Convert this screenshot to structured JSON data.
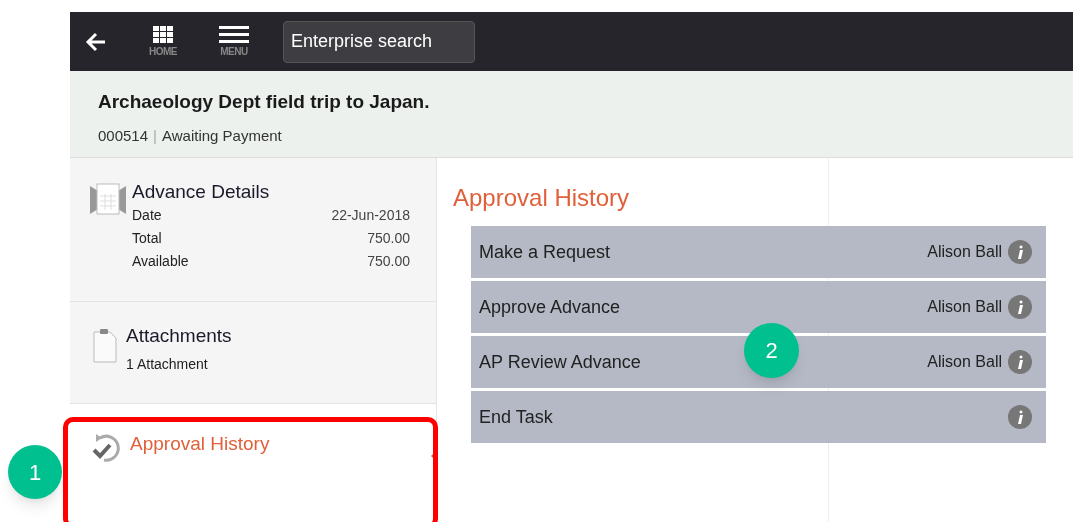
{
  "top_bar": {
    "home_label": "HOME",
    "menu_label": "MENU",
    "search": {
      "placeholder": "Enterprise search"
    }
  },
  "header": {
    "title": "Archaeology Dept field trip to Japan.",
    "number": "000514",
    "separator": "|",
    "status": "Awaiting Payment"
  },
  "sidebar": {
    "items": [
      {
        "kind": "details",
        "title": "Advance Details",
        "selected": false,
        "fields": [
          {
            "label": "Date",
            "value": "22-Jun-2018"
          },
          {
            "label": "Total",
            "value": "750.00"
          },
          {
            "label": "Available",
            "value": "750.00"
          }
        ]
      },
      {
        "kind": "attachments",
        "title": "Attachments",
        "selected": false,
        "subtitle": "1 Attachment"
      },
      {
        "kind": "history",
        "title": "Approval History",
        "selected": true
      }
    ]
  },
  "content": {
    "heading": "Approval History",
    "rows": [
      {
        "step": "Make a Request",
        "user": "Alison Ball"
      },
      {
        "step": "Approve Advance",
        "user": "Alison Ball"
      },
      {
        "step": "AP Review Advance",
        "user": "Alison Ball"
      },
      {
        "step": "End Task"
      }
    ]
  },
  "callouts": [
    {
      "label": "1"
    },
    {
      "label": "2"
    }
  ]
}
